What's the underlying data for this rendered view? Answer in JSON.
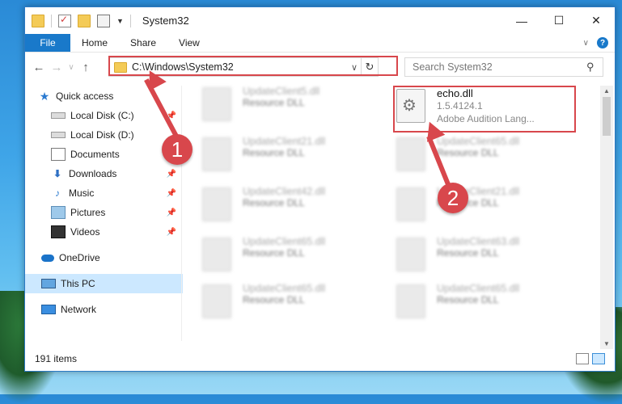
{
  "window": {
    "title": "System32",
    "controls": {
      "minimize": "—",
      "maximize": "☐",
      "close": "✕"
    }
  },
  "ribbon": {
    "file": "File",
    "tabs": [
      "Home",
      "Share",
      "View"
    ]
  },
  "nav": {
    "back": "←",
    "forward": "→",
    "recent": "∨",
    "up": "↑"
  },
  "address": {
    "path": "C:\\Windows\\System32",
    "dropdown": "∨",
    "refresh": "↻"
  },
  "search": {
    "placeholder": "Search System32",
    "icon": "⚲"
  },
  "sidebar": {
    "items": [
      {
        "label": "Quick access",
        "icon": "star-icon"
      },
      {
        "label": "Local Disk (C:)",
        "icon": "drive-icon"
      },
      {
        "label": "Local Disk (D:)",
        "icon": "drive-icon"
      },
      {
        "label": "Documents",
        "icon": "documents-icon"
      },
      {
        "label": "Downloads",
        "icon": "downloads-icon"
      },
      {
        "label": "Music",
        "icon": "music-icon"
      },
      {
        "label": "Pictures",
        "icon": "pictures-icon"
      },
      {
        "label": "Videos",
        "icon": "videos-icon"
      },
      {
        "label": "OneDrive",
        "icon": "onedrive-icon"
      },
      {
        "label": "This PC",
        "icon": "pc-icon"
      },
      {
        "label": "Network",
        "icon": "network-icon"
      }
    ]
  },
  "files": [
    {
      "name": "UpdateClient5.dll",
      "type": "Resource DLL"
    },
    {
      "name": "echo.dll",
      "version": "1.5.4124.1",
      "type": "Adobe Audition Lang..."
    },
    {
      "name": "UpdateClient21.dll",
      "type": "Resource DLL"
    },
    {
      "name": "UpdateClient65.dll",
      "type": "Resource DLL"
    },
    {
      "name": "UpdateClient42.dll",
      "type": "Resource DLL"
    },
    {
      "name": "UpdateClient21.dll",
      "type": "Resource DLL"
    },
    {
      "name": "UpdateClient65.dll",
      "type": "Resource DLL"
    },
    {
      "name": "UpdateClient63.dll",
      "type": "Resource DLL"
    },
    {
      "name": "UpdateClient65.dll",
      "type": "Resource DLL"
    },
    {
      "name": "UpdateClient65.dll",
      "type": "Resource DLL"
    }
  ],
  "status": {
    "count": "191 items"
  },
  "callouts": {
    "one": "1",
    "two": "2"
  },
  "colors": {
    "accent": "#1979ca",
    "highlight": "#d8474c",
    "selected": "#cce8ff"
  }
}
